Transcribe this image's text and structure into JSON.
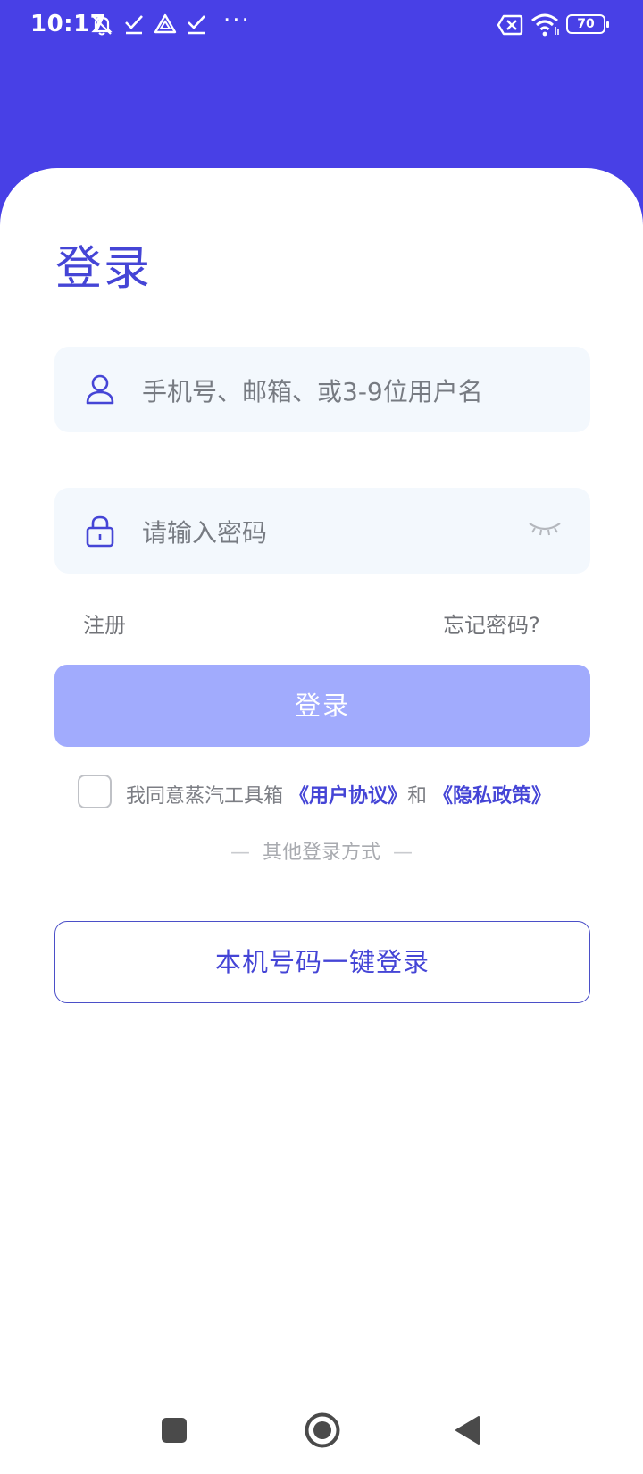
{
  "status_bar": {
    "time": "10:17",
    "dots": "···",
    "battery": "70",
    "icons": [
      "mute-icon",
      "check-icon",
      "triangle-app-icon",
      "check-icon",
      "sim-x-icon",
      "wifi-icon",
      "battery-icon"
    ]
  },
  "login": {
    "title": "登录",
    "username_placeholder": "手机号、邮箱、或3-9位用户名",
    "password_placeholder": "请输入密码",
    "register_label": "注册",
    "forgot_label": "忘记密码?",
    "login_button": "登录",
    "agree_prefix": "我同意蒸汽工具箱",
    "user_agreement": "《用户协议》",
    "and": "和",
    "privacy_policy": "《隐私政策》",
    "other_methods": "其他登录方式",
    "divider_dash": "—",
    "onekey_button": "本机号码一键登录"
  },
  "colors": {
    "header_bg": "#4840e6",
    "accent": "#4545d6",
    "button_disabled": "#a1abfd",
    "field_bg": "#f3f8fd"
  },
  "nav_bar": {
    "icons": [
      "recent-apps-icon",
      "home-icon",
      "back-icon"
    ]
  }
}
